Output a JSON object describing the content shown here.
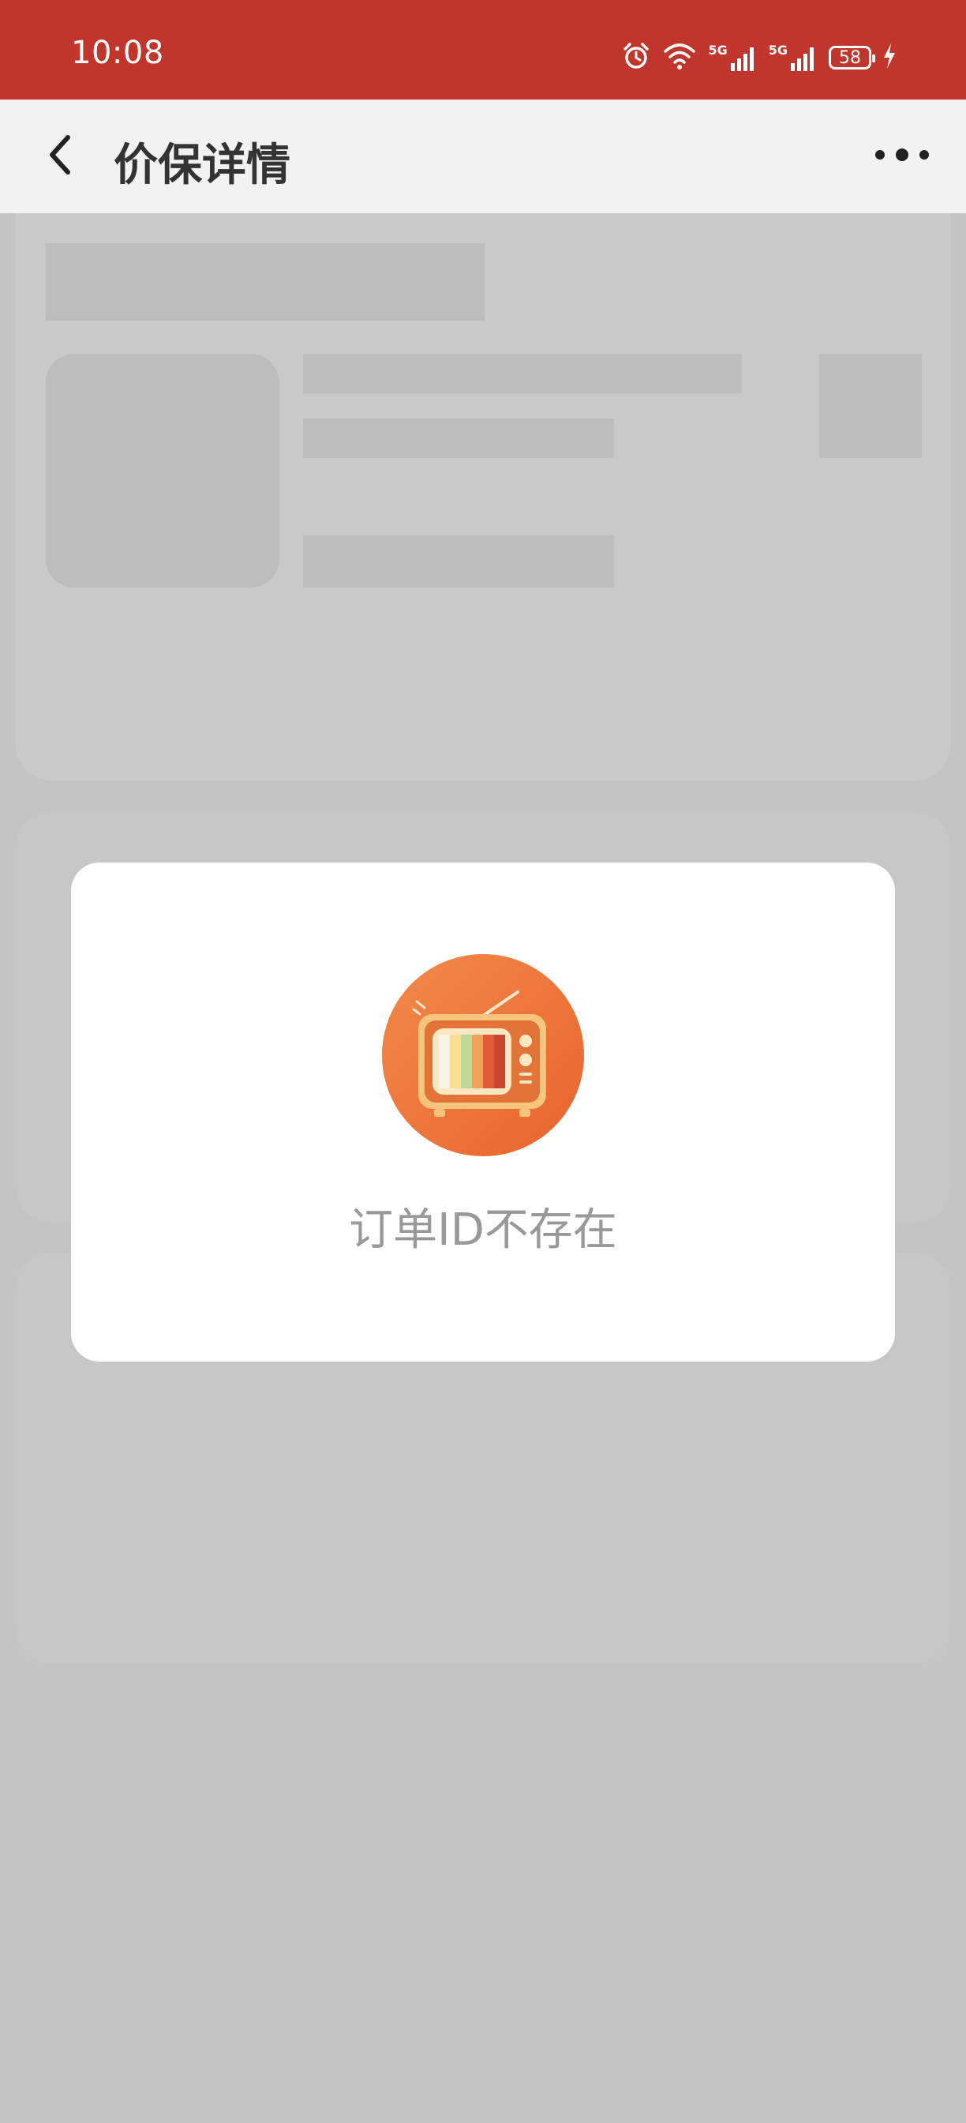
{
  "status_bar": {
    "time": "10:08",
    "network_1": "5G",
    "network_2": "5G",
    "battery": "58",
    "colors": {
      "background": "#c0352c"
    }
  },
  "nav": {
    "title": "价保详情",
    "back_icon": "chevron-left-icon",
    "more_icon": "more-dots-icon"
  },
  "modal": {
    "message": "订单ID不存在",
    "illustration": "tv-icon",
    "colors": {
      "circle": "#f07b3f",
      "text": "#999999"
    }
  }
}
